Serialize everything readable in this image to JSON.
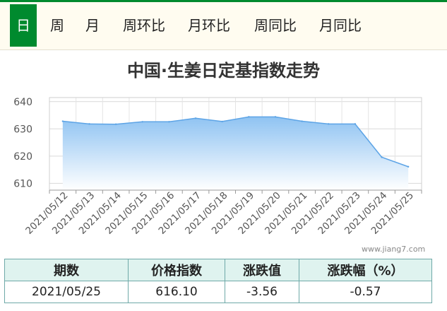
{
  "tabs": [
    {
      "label": "日",
      "active": true
    },
    {
      "label": "周",
      "active": false
    },
    {
      "label": "月",
      "active": false
    },
    {
      "label": "周环比",
      "active": false
    },
    {
      "label": "月环比",
      "active": false
    },
    {
      "label": "周同比",
      "active": false
    },
    {
      "label": "月同比",
      "active": false
    }
  ],
  "colors": {
    "accent": "#008a2e",
    "series_line": "#5da4e6",
    "series_fill": "#8fc3f2"
  },
  "chart_data": {
    "type": "area",
    "title": "中国·生姜日定基指数走势",
    "x": [
      "2021/05/12",
      "2021/05/13",
      "2021/05/14",
      "2021/05/15",
      "2021/05/16",
      "2021/05/17",
      "2021/05/18",
      "2021/05/19",
      "2021/05/20",
      "2021/05/21",
      "2021/05/22",
      "2021/05/23",
      "2021/05/24",
      "2021/05/25"
    ],
    "values": [
      632.8,
      631.8,
      631.7,
      632.6,
      632.6,
      633.9,
      632.7,
      634.4,
      634.4,
      632.8,
      631.8,
      631.8,
      619.6,
      616.1
    ],
    "yticks": [
      610,
      620,
      630,
      640
    ],
    "ylim": [
      607.5,
      641.5
    ],
    "grid": true,
    "xlabel": "",
    "ylabel": ""
  },
  "watermark": "www.jiang7.com",
  "table": {
    "headers": [
      "期数",
      "价格指数",
      "涨跌值",
      "涨跌幅（%）"
    ],
    "row": [
      "2021/05/25",
      "616.10",
      "-3.56",
      "-0.57"
    ]
  }
}
